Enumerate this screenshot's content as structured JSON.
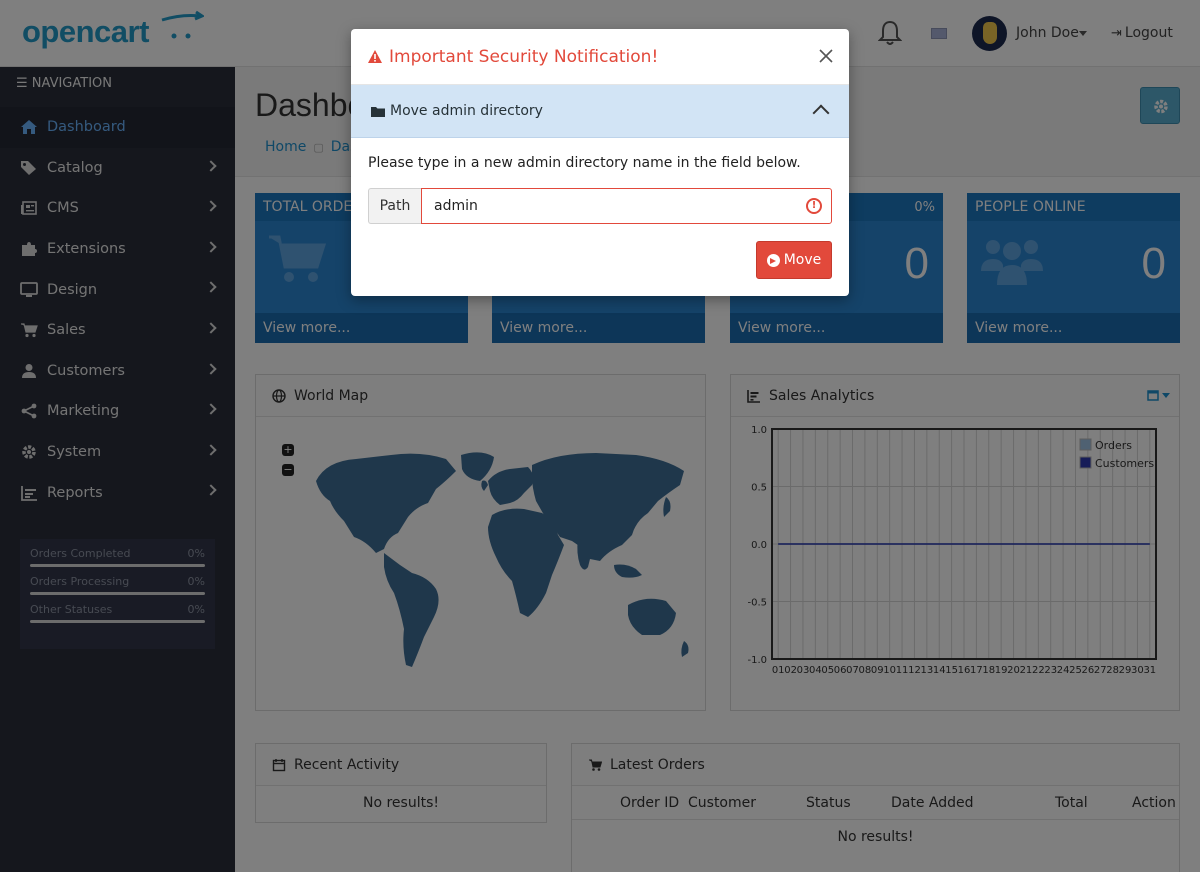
{
  "header": {
    "logo_text": "opencart",
    "user_name": "John Doe",
    "logout_label": "Logout"
  },
  "sidebar": {
    "title": "NAVIGATION",
    "items": [
      {
        "label": "Dashboard",
        "icon": "home-icon"
      },
      {
        "label": "Catalog",
        "icon": "tag-icon"
      },
      {
        "label": "CMS",
        "icon": "newspaper-icon"
      },
      {
        "label": "Extensions",
        "icon": "puzzle-icon"
      },
      {
        "label": "Design",
        "icon": "monitor-icon"
      },
      {
        "label": "Sales",
        "icon": "cart-icon"
      },
      {
        "label": "Customers",
        "icon": "user-icon"
      },
      {
        "label": "Marketing",
        "icon": "share-icon"
      },
      {
        "label": "System",
        "icon": "gear-icon"
      },
      {
        "label": "Reports",
        "icon": "bar-chart-icon"
      }
    ],
    "stats": [
      {
        "label": "Orders Completed",
        "value": "0%"
      },
      {
        "label": "Orders Processing",
        "value": "0%"
      },
      {
        "label": "Other Statuses",
        "value": "0%"
      }
    ]
  },
  "page": {
    "title": "Dashboard",
    "breadcrumb": [
      "Home",
      "Dashboard"
    ]
  },
  "tiles": [
    {
      "title": "TOTAL ORDERS",
      "pct": "",
      "value": "",
      "foot": "View more..."
    },
    {
      "title": "",
      "pct": "",
      "value": "",
      "foot": "View more..."
    },
    {
      "title": "",
      "pct": "0%",
      "value": "0",
      "foot": "View more..."
    },
    {
      "title": "PEOPLE ONLINE",
      "pct": "",
      "value": "0",
      "foot": "View more..."
    }
  ],
  "world_map": {
    "title": "World Map",
    "zoom_in": "+",
    "zoom_out": "−"
  },
  "sales": {
    "title": "Sales Analytics"
  },
  "chart_data": {
    "type": "line",
    "x": [
      "01",
      "02",
      "03",
      "04",
      "05",
      "06",
      "07",
      "08",
      "09",
      "10",
      "11",
      "12",
      "13",
      "14",
      "15",
      "16",
      "17",
      "18",
      "19",
      "20",
      "21",
      "22",
      "23",
      "24",
      "25",
      "26",
      "27",
      "28",
      "29",
      "30",
      "31"
    ],
    "series": [
      {
        "name": "Orders",
        "color": "#9fc3e4",
        "values": [
          0,
          0,
          0,
          0,
          0,
          0,
          0,
          0,
          0,
          0,
          0,
          0,
          0,
          0,
          0,
          0,
          0,
          0,
          0,
          0,
          0,
          0,
          0,
          0,
          0,
          0,
          0,
          0,
          0,
          0,
          0
        ]
      },
      {
        "name": "Customers",
        "color": "#2f3ab0",
        "values": [
          0,
          0,
          0,
          0,
          0,
          0,
          0,
          0,
          0,
          0,
          0,
          0,
          0,
          0,
          0,
          0,
          0,
          0,
          0,
          0,
          0,
          0,
          0,
          0,
          0,
          0,
          0,
          0,
          0,
          0,
          0
        ]
      }
    ],
    "ylim": [
      -1.0,
      1.0
    ],
    "yticks": [
      "1.0",
      "0.5",
      "0.0",
      "-0.5",
      "-1.0"
    ],
    "legend": "top-right",
    "grid": true
  },
  "recent": {
    "title": "Recent Activity",
    "empty": "No results!"
  },
  "latest": {
    "title": "Latest Orders",
    "columns": [
      "Order ID",
      "Customer",
      "Status",
      "Date Added",
      "Total",
      "Action"
    ],
    "empty": "No results!"
  },
  "modal": {
    "title": "Important Security Notification!",
    "section": "Move admin directory",
    "description": "Please type in a new admin directory name in the field below.",
    "path_label": "Path",
    "path_value": "admin",
    "move_label": "Move"
  },
  "colors": {
    "accent": "#1e91cf",
    "danger": "#e2493b",
    "tile": "#2a86d3"
  }
}
